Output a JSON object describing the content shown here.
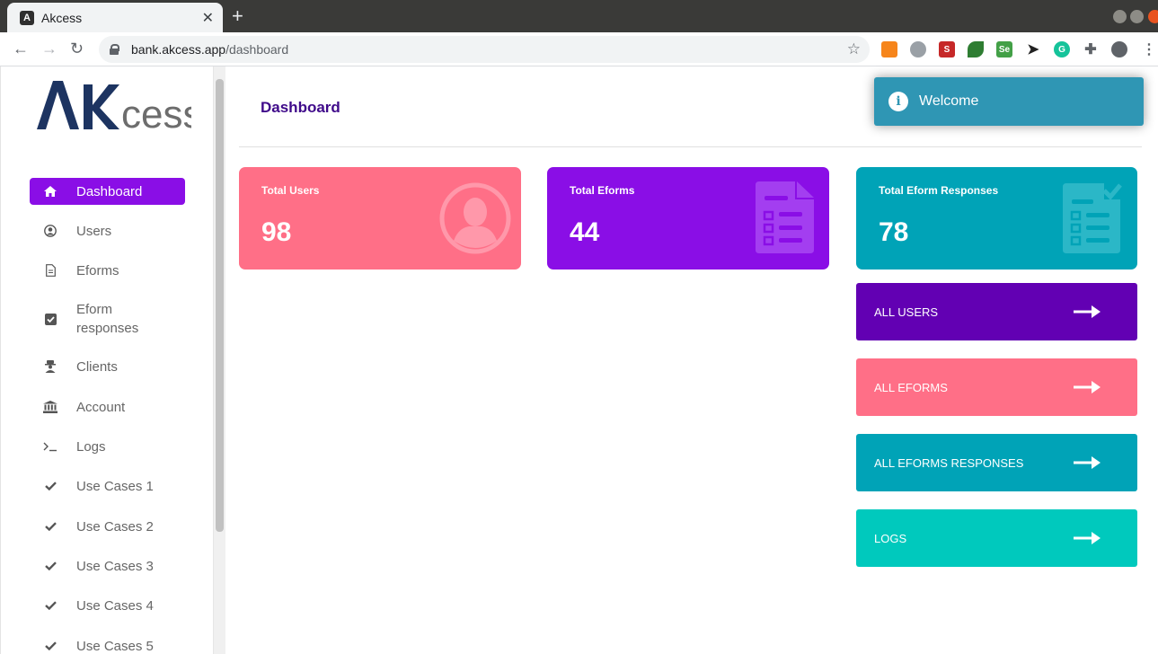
{
  "browser": {
    "tab_title": "Akcess",
    "tab_favicon": "A",
    "tab_close": "✕",
    "new_tab": "+",
    "url_host": "bank.akcess.app",
    "url_path": "/dashboard",
    "extension_icons": [
      "metamask-fox-icon",
      "globe-icon",
      "s-shield-icon",
      "leaf-icon",
      "selenium-icon",
      "cursor-icon",
      "grammarly-icon",
      "puzzle-icon",
      "profile-icon",
      "menu-dots-icon"
    ]
  },
  "logo": {
    "text": "AKcess",
    "colors": {
      "primary": "#1d3461",
      "secondary": "#6d6d6d"
    }
  },
  "sidebar": {
    "items": [
      {
        "label": "Dashboard",
        "icon": "home-icon",
        "active": true
      },
      {
        "label": "Users",
        "icon": "user-circle-icon"
      },
      {
        "label": "Eforms",
        "icon": "file-icon"
      },
      {
        "label": "Eform responses",
        "icon": "check-square-icon"
      },
      {
        "label": "Clients",
        "icon": "user-secret-icon"
      },
      {
        "label": "Account",
        "icon": "bank-icon"
      },
      {
        "label": "Logs",
        "icon": "terminal-icon"
      },
      {
        "label": "Use Cases 1",
        "icon": "check-icon"
      },
      {
        "label": "Use Cases 2",
        "icon": "check-icon"
      },
      {
        "label": "Use Cases 3",
        "icon": "check-icon"
      },
      {
        "label": "Use Cases 4",
        "icon": "check-icon"
      },
      {
        "label": "Use Cases 5",
        "icon": "check-icon"
      }
    ]
  },
  "main": {
    "title": "Dashboard",
    "stats": [
      {
        "label": "Total Users",
        "value": "98",
        "color": "#ff6f87",
        "icon": "user-circle-icon"
      },
      {
        "label": "Total Eforms",
        "value": "44",
        "color": "#8a0ee6",
        "icon": "document-icon"
      },
      {
        "label": "Total Eform Responses",
        "value": "78",
        "color": "#00a3b7",
        "icon": "checklist-icon"
      }
    ],
    "links": [
      {
        "label": "ALL USERS",
        "color": "#6200b3"
      },
      {
        "label": "ALL EFORMS",
        "color": "#ff6f87"
      },
      {
        "label": "ALL EFORMS RESPONSES",
        "color": "#00a3b7"
      },
      {
        "label": "LOGS",
        "color": "#00c9bd"
      }
    ]
  },
  "toast": {
    "text": "Welcome",
    "icon": "info-icon",
    "color": "#2f96b4"
  }
}
